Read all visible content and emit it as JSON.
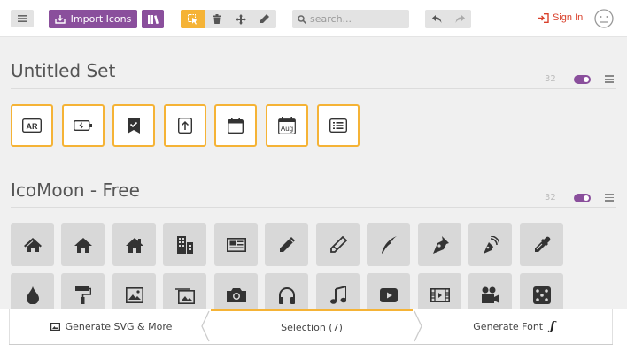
{
  "toolbar": {
    "import_label": "Import Icons",
    "search_placeholder": "search...",
    "signin_label": "Sign In"
  },
  "sets": [
    {
      "title": "Untitled Set",
      "count": "32"
    },
    {
      "title": "IcoMoon - Free",
      "count": "32"
    }
  ],
  "selected_icons": [
    {
      "icon": "ar-icon",
      "glyph": "AR"
    },
    {
      "icon": "battery-charging-icon"
    },
    {
      "icon": "bookmark-check-icon"
    },
    {
      "icon": "upload-box-icon"
    },
    {
      "icon": "calendar-blank-icon"
    },
    {
      "icon": "calendar-aug-icon",
      "glyph": "Aug"
    },
    {
      "icon": "list-box-icon"
    }
  ],
  "free_icons_row1": [
    "home-icon",
    "home2-icon",
    "home3-icon",
    "office-icon",
    "newspaper-icon",
    "pencil-icon",
    "pencil2-icon",
    "quill-icon",
    "pen-icon",
    "blog-icon",
    "eyedropper-icon"
  ],
  "free_icons_row2": [
    "droplet-icon",
    "paint-format-icon",
    "image-icon",
    "images-icon",
    "camera-icon",
    "headphones-icon",
    "music-icon",
    "play-icon",
    "film-icon",
    "video-camera-icon",
    "dice-icon"
  ],
  "bottombar": {
    "generate_svg_label": "Generate SVG & More",
    "selection_label": "Selection (7)",
    "generate_font_label": "Generate Font"
  },
  "colors": {
    "accent_purple": "#8a4f9c",
    "selection_orange": "#f5b336",
    "signin_red": "#d9402b"
  }
}
